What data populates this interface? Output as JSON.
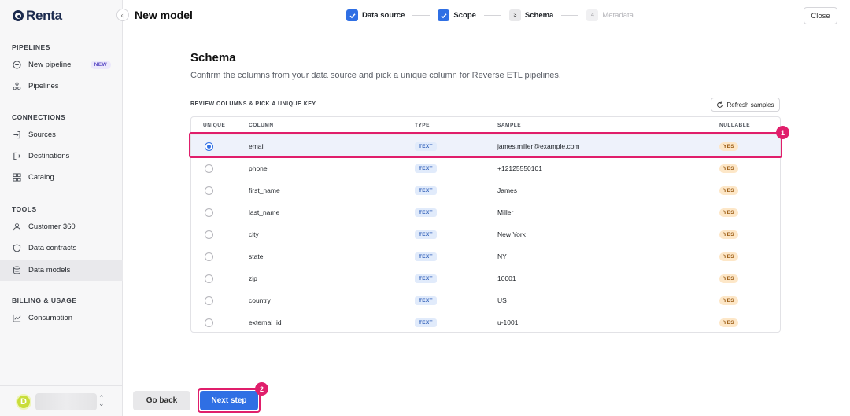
{
  "app": {
    "logo_text": "Renta"
  },
  "sidebar": {
    "sections": [
      {
        "label": "PIPELINES"
      },
      {
        "label": "CONNECTIONS"
      },
      {
        "label": "TOOLS"
      },
      {
        "label": "BILLING & USAGE"
      }
    ],
    "items": [
      {
        "label": "New pipeline",
        "icon": "plus-circle-icon",
        "badge": "NEW"
      },
      {
        "label": "Pipelines",
        "icon": "nodes-icon"
      },
      {
        "label": "Sources",
        "icon": "log-in-icon"
      },
      {
        "label": "Destinations",
        "icon": "log-out-icon"
      },
      {
        "label": "Catalog",
        "icon": "grid-icon"
      },
      {
        "label": "Customer 360",
        "icon": "user-icon"
      },
      {
        "label": "Data contracts",
        "icon": "shield-icon"
      },
      {
        "label": "Data models",
        "icon": "database-icon",
        "active": true
      },
      {
        "label": "Consumption",
        "icon": "chart-line-icon"
      }
    ],
    "user": {
      "avatar_letter": "D"
    }
  },
  "header": {
    "title": "New model",
    "steps": [
      {
        "label": "Data source",
        "state": "done"
      },
      {
        "label": "Scope",
        "state": "done"
      },
      {
        "number": "3",
        "label": "Schema",
        "state": "current"
      },
      {
        "number": "4",
        "label": "Metadata",
        "state": "upcoming"
      }
    ],
    "close_label": "Close"
  },
  "main": {
    "title": "Schema",
    "subtitle": "Confirm the columns from your data source and pick a unique column for Reverse ETL pipelines.",
    "table_label": "REVIEW COLUMNS & PICK A UNIQUE KEY",
    "refresh_label": "Refresh samples",
    "columns": [
      "UNIQUE",
      "COLUMN",
      "TYPE",
      "SAMPLE",
      "NULLABLE"
    ],
    "rows": [
      {
        "column": "email",
        "type": "TEXT",
        "sample": "james.miller@example.com",
        "nullable": "YES",
        "unique": true
      },
      {
        "column": "phone",
        "type": "TEXT",
        "sample": "+12125550101",
        "nullable": "YES",
        "unique": false
      },
      {
        "column": "first_name",
        "type": "TEXT",
        "sample": "James",
        "nullable": "YES",
        "unique": false
      },
      {
        "column": "last_name",
        "type": "TEXT",
        "sample": "Miller",
        "nullable": "YES",
        "unique": false
      },
      {
        "column": "city",
        "type": "TEXT",
        "sample": "New York",
        "nullable": "YES",
        "unique": false
      },
      {
        "column": "state",
        "type": "TEXT",
        "sample": "NY",
        "nullable": "YES",
        "unique": false
      },
      {
        "column": "zip",
        "type": "TEXT",
        "sample": "10001",
        "nullable": "YES",
        "unique": false
      },
      {
        "column": "country",
        "type": "TEXT",
        "sample": "US",
        "nullable": "YES",
        "unique": false
      },
      {
        "column": "external_id",
        "type": "TEXT",
        "sample": "u-1001",
        "nullable": "YES",
        "unique": false
      }
    ]
  },
  "footer": {
    "back_label": "Go back",
    "next_label": "Next step"
  },
  "annotations": {
    "marker_1": "1",
    "marker_2": "2"
  },
  "colors": {
    "accent": "#2f6fe4",
    "highlight": "#e01e6b",
    "type_pill": "#e1ebfb",
    "yes_pill": "#fde7c8"
  }
}
